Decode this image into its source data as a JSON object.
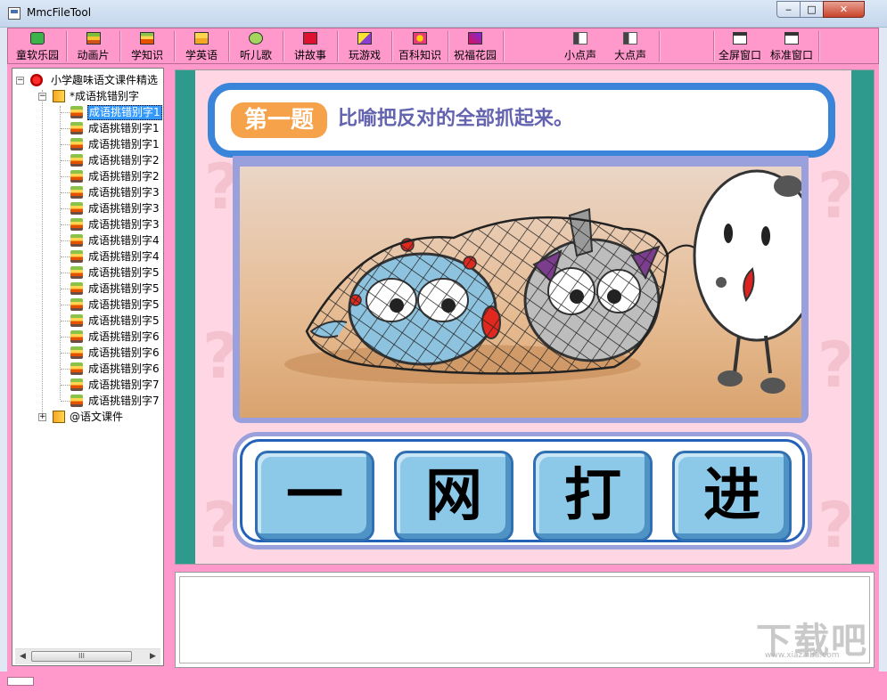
{
  "window": {
    "title": "MmcFileTool",
    "minimize_label": "‒",
    "maximize_label": "□",
    "close_label": "✕"
  },
  "toolbar": {
    "buttons": [
      {
        "label": "童软乐园",
        "icon": "smiley-green-icon"
      },
      {
        "label": "动画片",
        "icon": "film-icon"
      },
      {
        "label": "学知识",
        "icon": "cake-icon"
      },
      {
        "label": "学英语",
        "icon": "book-icon"
      },
      {
        "label": "听儿歌",
        "icon": "music-icon"
      },
      {
        "label": "讲故事",
        "icon": "story-icon"
      },
      {
        "label": "玩游戏",
        "icon": "game-icon"
      },
      {
        "label": "百科知识",
        "icon": "encyclopedia-icon"
      },
      {
        "label": "祝福花园",
        "icon": "garden-icon"
      },
      {
        "label": "小点声",
        "icon": "volume-down-icon"
      },
      {
        "label": "大点声",
        "icon": "volume-up-icon"
      },
      {
        "label": "全屏窗口",
        "icon": "fullscreen-icon"
      },
      {
        "label": "标准窗口",
        "icon": "window-icon"
      }
    ]
  },
  "tree": {
    "root_label": "小学趣味语文课件精选",
    "group_label": "*成语挑错别字",
    "items": [
      "成语挑错别字1",
      "成语挑错别字1",
      "成语挑错别字1",
      "成语挑错别字2",
      "成语挑错别字2",
      "成语挑错别字3",
      "成语挑错别字3",
      "成语挑错别字3",
      "成语挑错别字4",
      "成语挑错别字4",
      "成语挑错别字5",
      "成语挑错别字5",
      "成语挑错别字5",
      "成语挑错别字5",
      "成语挑错别字6",
      "成语挑错别字6",
      "成语挑错别字6",
      "成语挑错别字7",
      "成语挑错别字7"
    ],
    "selected_index": 0,
    "second_group_label": "@语文课件",
    "scroll_thumb_label": "III"
  },
  "lesson": {
    "question_tag": "第一题",
    "question_text": "比喻把反对的全部抓起来。",
    "answers": [
      "一",
      "网",
      "打",
      "进"
    ]
  },
  "watermark": {
    "text": "下载吧",
    "url": "www.xiazaiba.com"
  },
  "colors": {
    "toolbar_pink": "#ff99cc",
    "teal": "#2e9a8e",
    "banner_blue": "#3a84da",
    "tag_orange": "#f6a24a",
    "question_purple": "#6363b0",
    "answer_blue": "#8cc8e8"
  }
}
